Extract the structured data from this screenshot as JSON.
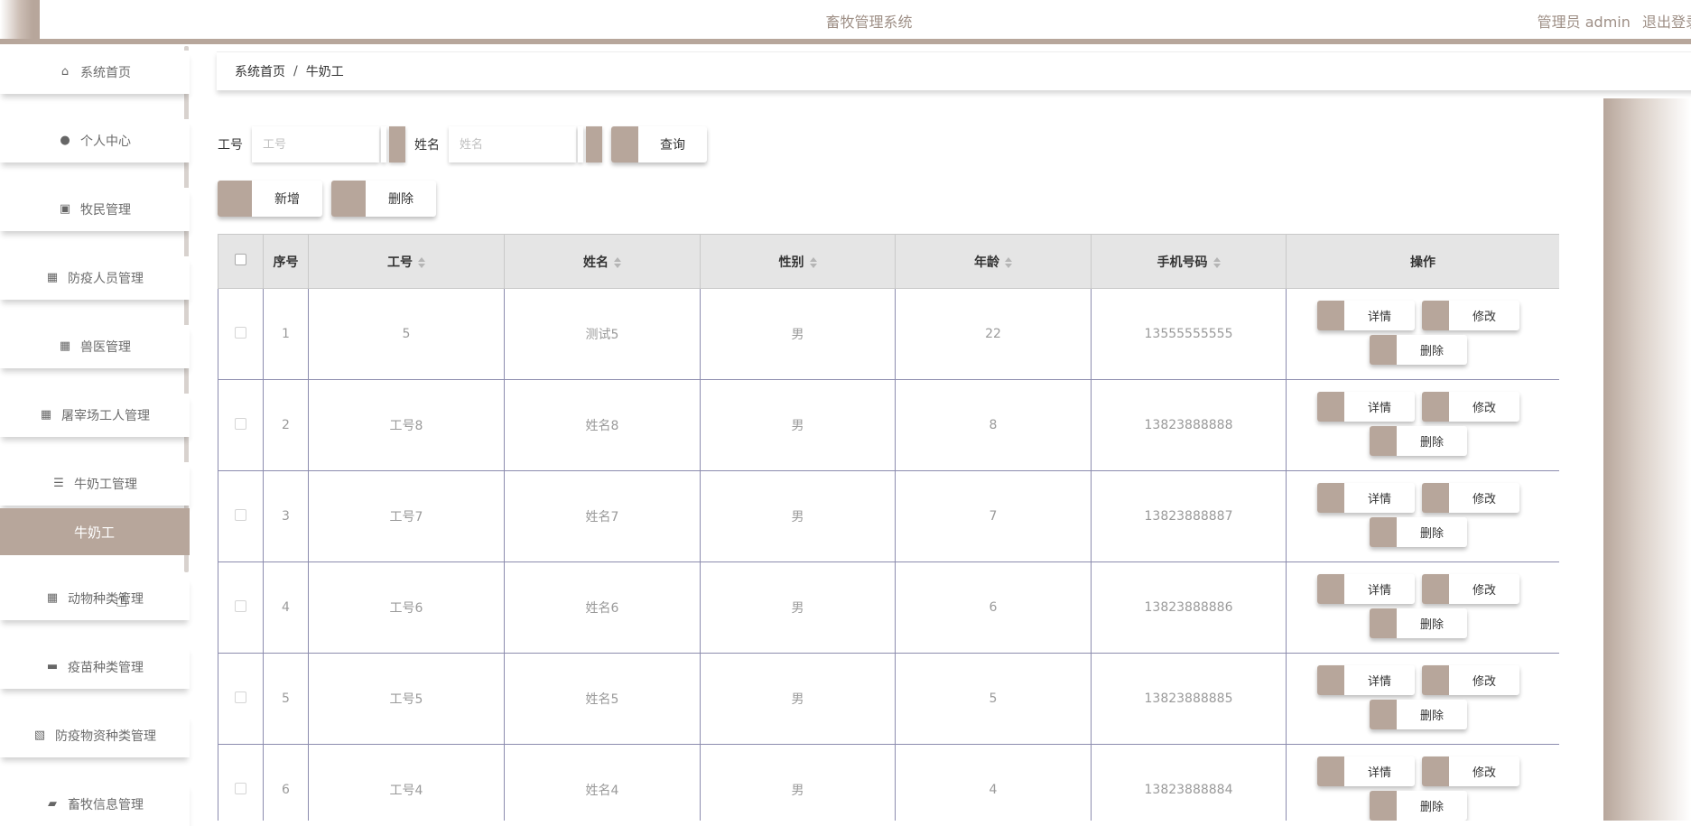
{
  "header": {
    "app_title": "畜牧管理系统",
    "user_label": "管理员 admin",
    "logout_label": "退出登录"
  },
  "sidebar": {
    "items": [
      {
        "label": "系统首页",
        "icon": "home-icon"
      },
      {
        "label": "个人中心",
        "icon": "user-icon"
      },
      {
        "label": "牧民管理",
        "icon": "clipboard-check-icon"
      },
      {
        "label": "防疫人员管理",
        "icon": "grid-icon"
      },
      {
        "label": "兽医管理",
        "icon": "grid-icon"
      },
      {
        "label": "屠宰场工人管理",
        "icon": "grid-icon"
      },
      {
        "label": "牛奶工管理",
        "icon": "list-icon"
      },
      {
        "label": "牛奶工",
        "icon": ""
      },
      {
        "label": "动物种类管理",
        "icon": "grid-icon"
      },
      {
        "label": "疫苗种类管理",
        "icon": "briefcase-icon"
      },
      {
        "label": "防疫物资种类管理",
        "icon": "clipboard-x-icon"
      },
      {
        "label": "畜牧信息管理",
        "icon": "ticket-icon"
      }
    ]
  },
  "breadcrumb": {
    "home": "系统首页",
    "separator": "/",
    "current": "牛奶工"
  },
  "search": {
    "id_label": "工号",
    "id_placeholder": "工号",
    "name_label": "姓名",
    "name_placeholder": "姓名",
    "query_button": "查询"
  },
  "actions": {
    "add_button": "新增",
    "delete_button": "删除"
  },
  "table": {
    "columns": [
      "序号",
      "工号",
      "姓名",
      "性别",
      "年龄",
      "手机号码",
      "操作"
    ],
    "rows": [
      {
        "index": "1",
        "id": "5",
        "name": "测试5",
        "gender": "男",
        "age": "22",
        "phone": "13555555555"
      },
      {
        "index": "2",
        "id": "工号8",
        "name": "姓名8",
        "gender": "男",
        "age": "8",
        "phone": "13823888888"
      },
      {
        "index": "3",
        "id": "工号7",
        "name": "姓名7",
        "gender": "男",
        "age": "7",
        "phone": "13823888887"
      },
      {
        "index": "4",
        "id": "工号6",
        "name": "姓名6",
        "gender": "男",
        "age": "6",
        "phone": "13823888886"
      },
      {
        "index": "5",
        "id": "工号5",
        "name": "姓名5",
        "gender": "男",
        "age": "5",
        "phone": "13823888885"
      },
      {
        "index": "6",
        "id": "工号4",
        "name": "姓名4",
        "gender": "男",
        "age": "4",
        "phone": "13823888884"
      }
    ],
    "row_buttons": {
      "detail": "详情",
      "edit": "修改",
      "delete": "删除"
    }
  },
  "colors": {
    "accent": "#b7a69b",
    "header_bg": "#e5e5e5"
  }
}
